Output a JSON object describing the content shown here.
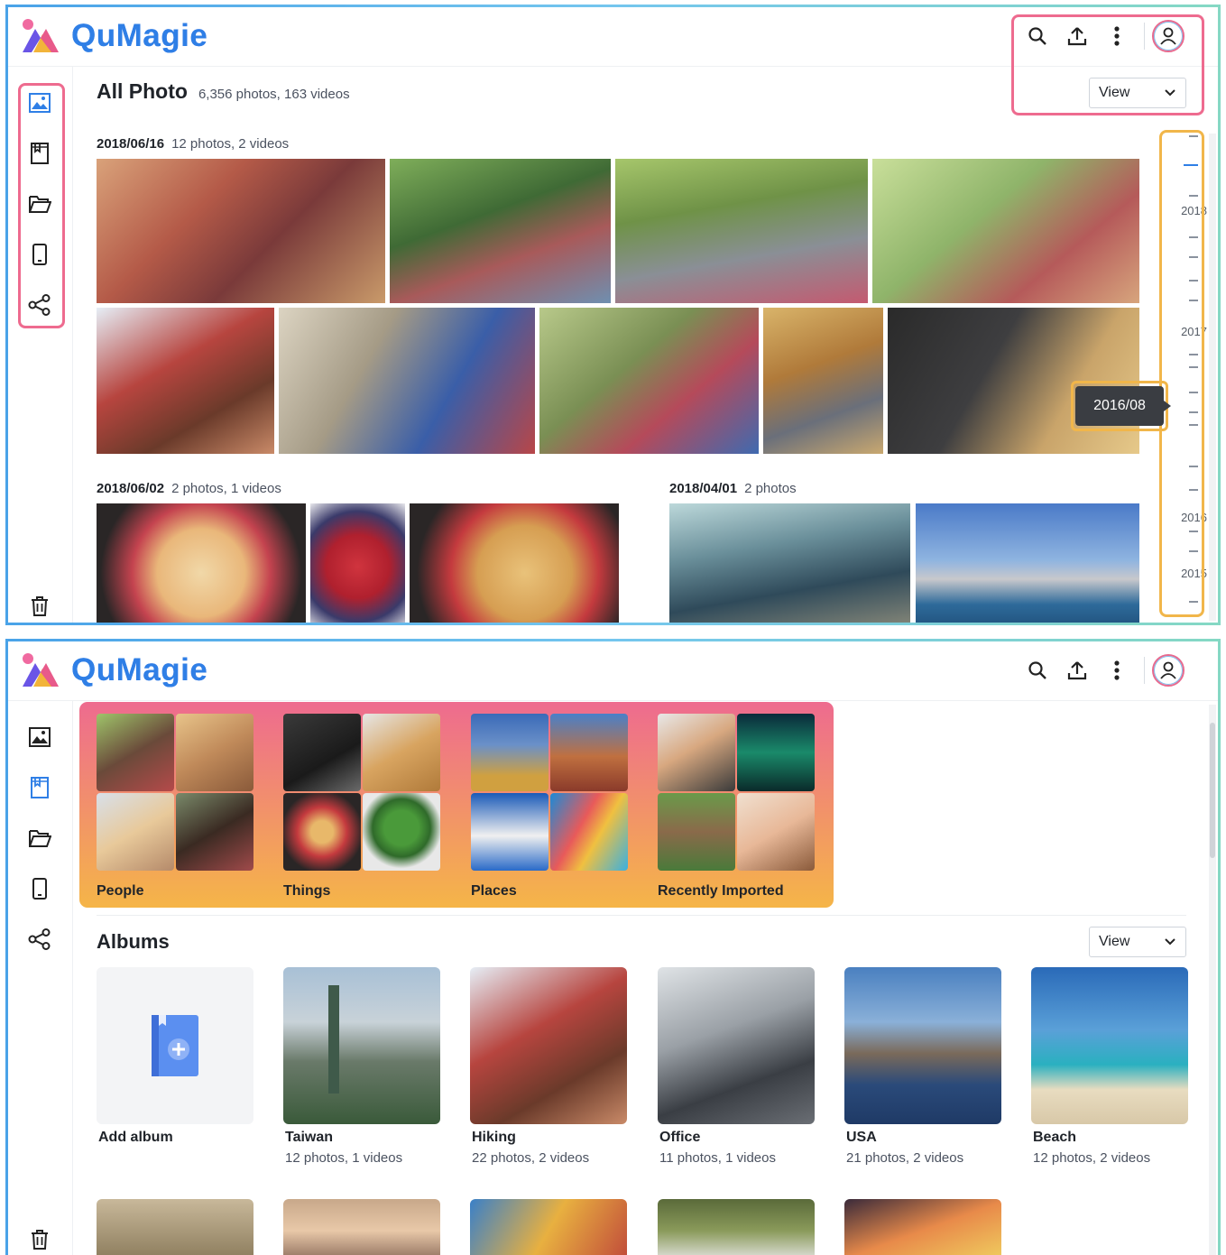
{
  "app": {
    "name": "QuMagie",
    "accent": "#2f7fe6",
    "highlight_colors": [
      "#ee6b8f",
      "#f1b64a"
    ]
  },
  "icons": {
    "search": "search-icon",
    "upload": "upload-icon",
    "more": "more-vert-icon",
    "avatar": "user-icon",
    "photos": "photo-icon",
    "albums": "album-icon",
    "folders": "folder-icon",
    "devices": "phone-icon",
    "share": "share-icon",
    "trash": "trash-icon",
    "chevron": "chevron-down-icon"
  },
  "top": {
    "title": "All Photo",
    "subtitle": "6,356 photos, 163 videos",
    "view_label": "View",
    "groups": [
      {
        "date": "2018/06/16",
        "count": "12 photos, 2 videos"
      },
      {
        "date": "2018/06/02",
        "count": "2 photos, 1 videos"
      },
      {
        "date": "2018/04/01",
        "count": "2 photos"
      }
    ],
    "timeline": {
      "years": [
        "2018",
        "2017",
        "2016",
        "2015"
      ],
      "tooltip": "2016/08"
    }
  },
  "bottom": {
    "smart": [
      {
        "label": "People"
      },
      {
        "label": "Things"
      },
      {
        "label": "Places"
      },
      {
        "label": "Recently Imported"
      }
    ],
    "albums_title": "Albums",
    "view_label": "View",
    "albums": [
      {
        "name": "Add album",
        "meta": ""
      },
      {
        "name": "Taiwan",
        "meta": "12 photos, 1 videos"
      },
      {
        "name": "Hiking",
        "meta": "22 photos, 2 videos"
      },
      {
        "name": "Office",
        "meta": "11 photos, 1 videos"
      },
      {
        "name": "USA",
        "meta": "21 photos, 2 videos"
      },
      {
        "name": "Beach",
        "meta": "12 photos, 2 videos"
      }
    ]
  }
}
